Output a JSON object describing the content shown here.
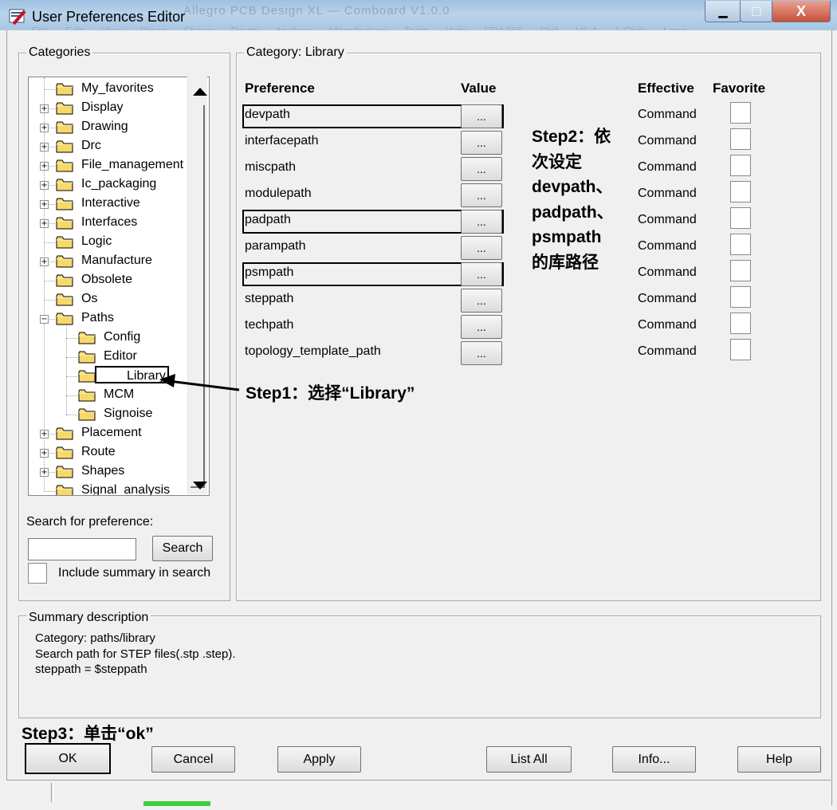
{
  "window": {
    "title": "User Preferences Editor",
    "background_title": "Allegro PCB Design XL — Comboard V1.0.0",
    "background_menu": "File  Edit  View  Place  Shape  Route  Analyze  Manufacture  Tools  Help  EDA365 Skill V1.4  1-Click Logo",
    "minimize_glyph": "▁",
    "maximize_glyph": "□",
    "close_glyph": "X"
  },
  "categories": {
    "title": "Categories",
    "tree": [
      {
        "label": "My_favorites",
        "level": 0,
        "expander": "none",
        "selected": false
      },
      {
        "label": "Display",
        "level": 0,
        "expander": "+",
        "selected": false
      },
      {
        "label": "Drawing",
        "level": 0,
        "expander": "+",
        "selected": false
      },
      {
        "label": "Drc",
        "level": 0,
        "expander": "+",
        "selected": false
      },
      {
        "label": "File_management",
        "level": 0,
        "expander": "+",
        "selected": false
      },
      {
        "label": "Ic_packaging",
        "level": 0,
        "expander": "+",
        "selected": false
      },
      {
        "label": "Interactive",
        "level": 0,
        "expander": "+",
        "selected": false
      },
      {
        "label": "Interfaces",
        "level": 0,
        "expander": "+",
        "selected": false
      },
      {
        "label": "Logic",
        "level": 0,
        "expander": "none",
        "selected": false
      },
      {
        "label": "Manufacture",
        "level": 0,
        "expander": "+",
        "selected": false
      },
      {
        "label": "Obsolete",
        "level": 0,
        "expander": "none",
        "selected": false
      },
      {
        "label": "Os",
        "level": 0,
        "expander": "none",
        "selected": false
      },
      {
        "label": "Paths",
        "level": 0,
        "expander": "−",
        "selected": false
      },
      {
        "label": "Config",
        "level": 1,
        "expander": "none",
        "selected": false
      },
      {
        "label": "Editor",
        "level": 1,
        "expander": "none",
        "selected": false
      },
      {
        "label": "Library",
        "level": 1,
        "expander": "none",
        "selected": true
      },
      {
        "label": "MCM",
        "level": 1,
        "expander": "none",
        "selected": false
      },
      {
        "label": "Signoise",
        "level": 1,
        "expander": "none",
        "selected": false
      },
      {
        "label": "Placement",
        "level": 0,
        "expander": "+",
        "selected": false
      },
      {
        "label": "Route",
        "level": 0,
        "expander": "+",
        "selected": false
      },
      {
        "label": "Shapes",
        "level": 0,
        "expander": "+",
        "selected": false
      },
      {
        "label": "Signal_analysis",
        "level": 0,
        "expander": "none",
        "selected": false
      }
    ],
    "search_label": "Search for preference:",
    "search_value": "",
    "search_button": "Search",
    "include_summary_label": "Include summary in search",
    "include_summary_checked": false
  },
  "category_panel": {
    "title": "Category:  Library",
    "headers": {
      "preference": "Preference",
      "value": "Value",
      "effective": "Effective",
      "favorite": "Favorite"
    },
    "rows": [
      {
        "name": "devpath",
        "value_button": "...",
        "effective": "Command",
        "favorite": false,
        "highlighted": true
      },
      {
        "name": "interfacepath",
        "value_button": "...",
        "effective": "Command",
        "favorite": false,
        "highlighted": false
      },
      {
        "name": "miscpath",
        "value_button": "...",
        "effective": "Command",
        "favorite": false,
        "highlighted": false
      },
      {
        "name": "modulepath",
        "value_button": "...",
        "effective": "Command",
        "favorite": false,
        "highlighted": false
      },
      {
        "name": "padpath",
        "value_button": "...",
        "effective": "Command",
        "favorite": false,
        "highlighted": true
      },
      {
        "name": "parampath",
        "value_button": "...",
        "effective": "Command",
        "favorite": false,
        "highlighted": false
      },
      {
        "name": "psmpath",
        "value_button": "...",
        "effective": "Command",
        "favorite": false,
        "highlighted": true
      },
      {
        "name": "steppath",
        "value_button": "...",
        "effective": "Command",
        "favorite": false,
        "highlighted": false
      },
      {
        "name": "techpath",
        "value_button": "...",
        "effective": "Command",
        "favorite": false,
        "highlighted": false
      },
      {
        "name": "topology_template_path",
        "value_button": "...",
        "effective": "Command",
        "favorite": false,
        "highlighted": false
      }
    ]
  },
  "annotations": {
    "step1": "Step1：选择“Library”",
    "step2_lines": [
      "Step2：依",
      "次设定",
      "devpath、",
      "padpath、",
      "psmpath",
      "的库路径"
    ],
    "step3": "Step3：单击“ok”"
  },
  "summary": {
    "title": "Summary description",
    "lines": [
      "Category: paths/library",
      "Search path for STEP files(.stp .step).",
      "steppath = $steppath"
    ]
  },
  "buttons": {
    "ok": "OK",
    "cancel": "Cancel",
    "apply": "Apply",
    "list_all": "List All",
    "info": "Info...",
    "help": "Help"
  },
  "colors": {
    "dialog_bg": "#f0f0f0",
    "folder_yellow": "#f5d76e",
    "annotation_black": "#000000",
    "titlebar_blue": "#a8c6e2"
  }
}
